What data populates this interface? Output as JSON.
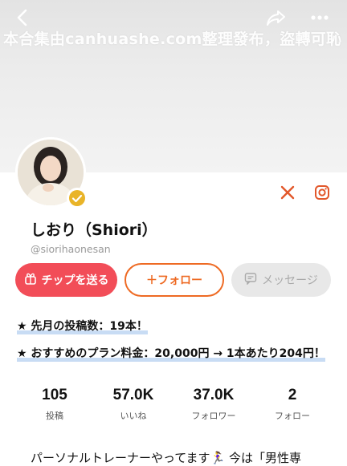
{
  "header": {
    "back_icon": "chevron-left-icon",
    "share_icon": "share-arrow-icon",
    "more_icon": "more-dots-icon",
    "watermark": "本合集由canhuashe.com整理發布，盜轉可恥"
  },
  "profile": {
    "display_name": "しおり（Shiori）",
    "handle": "@siorihaonesan",
    "verified": true,
    "social": {
      "x_icon": "x-logo-icon",
      "instagram_icon": "instagram-icon"
    }
  },
  "actions": {
    "tip_label": "チップを送る",
    "follow_label": "＋フォロー",
    "message_label": "メッセージ"
  },
  "info": [
    {
      "text": "★ 先月の投稿数：19本！"
    },
    {
      "text": "★ おすすめのプラン料金：20,000円 → 1本あたり204円！"
    }
  ],
  "stats": [
    {
      "value": "105",
      "label": "投稿"
    },
    {
      "value": "57.0K",
      "label": "いいね"
    },
    {
      "value": "37.0K",
      "label": "フォロワー"
    },
    {
      "value": "2",
      "label": "フォロー"
    }
  ],
  "bio": {
    "text": "パーソナルトレーナーやってます🏃‍♀️ 今は「男性専"
  },
  "colors": {
    "tip": "#f24d58",
    "follow": "#ee6a23",
    "message_bg": "#e8e8e8",
    "highlight": "#c8dcf4"
  }
}
